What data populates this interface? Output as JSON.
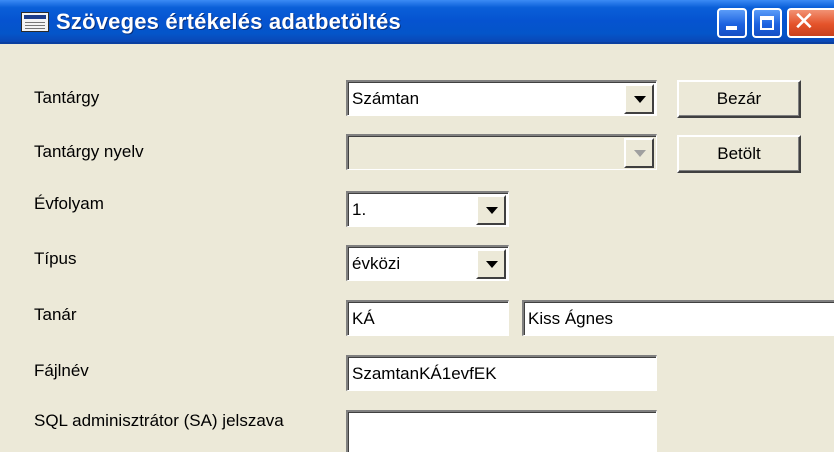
{
  "window": {
    "title": "Szöveges értékelés adatbetöltés",
    "icon": "form-window-icon",
    "controls": {
      "minimize": "minimize-icon",
      "maximize": "maximize-icon",
      "close": "close-icon",
      "close_glyph": "✕"
    }
  },
  "form": {
    "tantargy": {
      "label": "Tantárgy",
      "value": "Számtan"
    },
    "tantargy_nyelv": {
      "label": "Tantárgy nyelv",
      "value": ""
    },
    "evfolyam": {
      "label": "Évfolyam",
      "value": "1."
    },
    "tipus": {
      "label": "Típus",
      "value": "évközi"
    },
    "tanar": {
      "label": "Tanár",
      "code": "KÁ",
      "name": "Kiss Ágnes"
    },
    "fajlnev": {
      "label": "Fájlnév",
      "value": "SzamtanKÁ1evfEK"
    },
    "sa_jelszo": {
      "label": "SQL adminisztrátor (SA) jelszava",
      "value": ""
    }
  },
  "buttons": {
    "bezar": "Bezár",
    "betolt": "Betölt"
  },
  "colors": {
    "titlebar": "#0553d0",
    "face": "#ece9d8",
    "close": "#e4532a"
  }
}
